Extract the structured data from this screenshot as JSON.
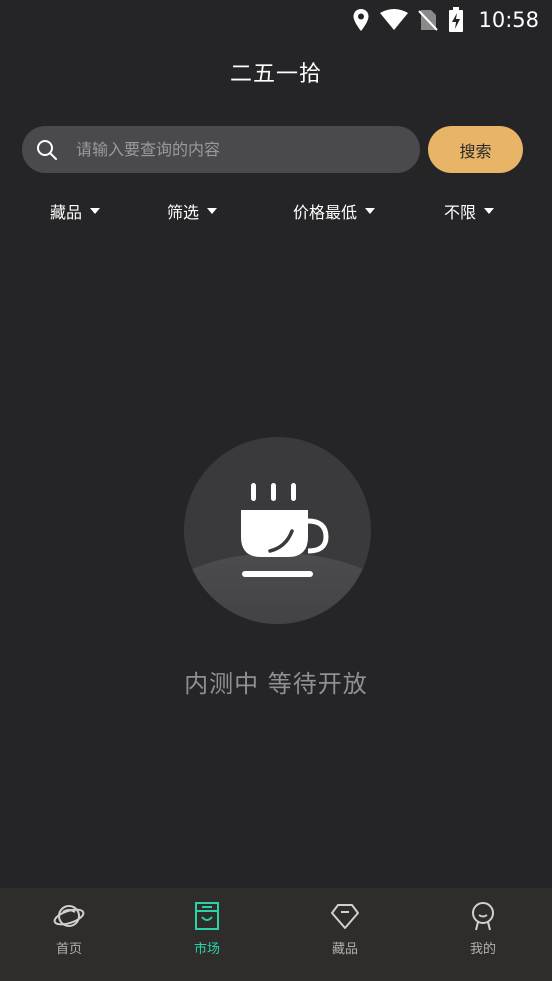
{
  "status_bar": {
    "time": "10:58"
  },
  "header": {
    "title": "二五一拾"
  },
  "search": {
    "placeholder": "请输入要查询的内容",
    "button_label": "搜索"
  },
  "filters": [
    {
      "label": "藏品"
    },
    {
      "label": "筛选"
    },
    {
      "label": "价格最低"
    },
    {
      "label": "不限"
    }
  ],
  "empty_state": {
    "message": "内测中 等待开放",
    "icon": "coffee-cup-icon"
  },
  "bottom_nav": {
    "items": [
      {
        "label": "首页",
        "icon": "planet-icon",
        "active": false
      },
      {
        "label": "市场",
        "icon": "market-icon",
        "active": true
      },
      {
        "label": "藏品",
        "icon": "diamond-icon",
        "active": false
      },
      {
        "label": "我的",
        "icon": "profile-icon",
        "active": false
      }
    ]
  },
  "colors": {
    "background": "#252527",
    "accent": "#e7b468",
    "active_tab": "#2ad3a6"
  }
}
